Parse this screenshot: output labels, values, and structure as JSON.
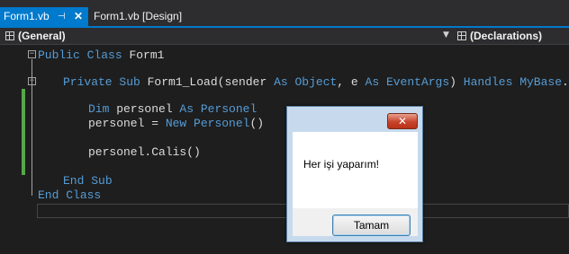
{
  "tabs": [
    {
      "label": "Form1.vb",
      "active": true,
      "pin_icon": "pin-icon",
      "close_icon": "close-icon"
    },
    {
      "label": "Form1.vb [Design]",
      "active": false
    }
  ],
  "navbar": {
    "left_label": "(General)",
    "right_label": "(Declarations)"
  },
  "code": {
    "l1": {
      "kw1": "Public",
      "sp": " ",
      "kw2": "Class",
      "rest": " Form1"
    },
    "l3": {
      "kw1": "Private",
      "s1": " ",
      "kw2": "Sub",
      "s2": " Form1_Load(sender ",
      "kw3": "As",
      "s3": " ",
      "ty1": "Object",
      "s4": ", e ",
      "kw4": "As",
      "s5": " ",
      "ty2": "EventArgs",
      "s6": ") ",
      "kw5": "Handles",
      "s7": " ",
      "kw6": "MyBase",
      "s8": ".Load"
    },
    "l5": {
      "kw1": "Dim",
      "s1": " personel ",
      "kw2": "As",
      "s2": " ",
      "ty1": "Personel"
    },
    "l6": {
      "s1": "personel = ",
      "kw1": "New",
      "s2": " ",
      "ty1": "Personel",
      "s3": "()"
    },
    "l8": {
      "s1": "personel.Calis()"
    },
    "l10": {
      "kw1": "End",
      "s1": " ",
      "kw2": "Sub"
    },
    "l11": {
      "kw1": "End",
      "s1": " ",
      "kw2": "Class"
    }
  },
  "message_box": {
    "text": "Her işi yaparım!",
    "ok_label": "Tamam",
    "close_glyph": "✕"
  },
  "colors": {
    "keyword": "#569cd6",
    "type": "#4ec9b0",
    "text": "#dcdcdc",
    "accent": "#007acc",
    "change_bar": "#57a64a"
  }
}
